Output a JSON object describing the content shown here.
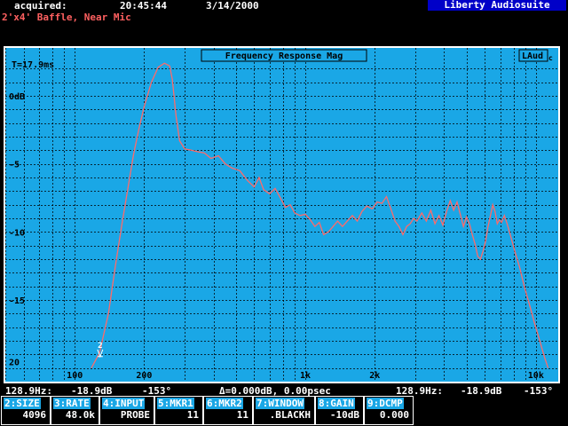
{
  "header": {
    "acquired_label": "acquired:",
    "time": "20:45:44",
    "date": "3/14/2000",
    "brand": "Liberty Audiosuite",
    "subtitle": "2'x4' Baffle, Near Mic"
  },
  "plot": {
    "title": "Frequency Response Mag",
    "logo": "LAud",
    "logo_sub": "c",
    "time_label": "T=17.9ms",
    "marker_label": "2",
    "background": "#1aa7e6",
    "trace_color": "#ff6a6a"
  },
  "chart_data": {
    "type": "line",
    "title": "Frequency Response Mag",
    "xscale": "log",
    "xlim": [
      50,
      12500
    ],
    "ylim": [
      -21,
      3
    ],
    "ylabel_ticks": [
      "0dB",
      "-5",
      "-10",
      "-15",
      "20"
    ],
    "ytick_values": [
      0,
      -5,
      -10,
      -15,
      -20
    ],
    "xtick_labels": [
      "100",
      "200",
      "1k",
      "2k",
      "10k"
    ],
    "xtick_values": [
      100,
      200,
      1000,
      2000,
      10000
    ],
    "grid": true,
    "series": [
      {
        "points": [
          [
            118,
            -20
          ],
          [
            128,
            -18.9
          ],
          [
            140,
            -16
          ],
          [
            150,
            -12.5
          ],
          [
            160,
            -9.5
          ],
          [
            170,
            -6.8
          ],
          [
            180,
            -4.3
          ],
          [
            190,
            -2.4
          ],
          [
            200,
            -0.8
          ],
          [
            215,
            1
          ],
          [
            230,
            2.1
          ],
          [
            245,
            2.4
          ],
          [
            258,
            2.2
          ],
          [
            265,
            1.2
          ],
          [
            275,
            -1.5
          ],
          [
            285,
            -3.3
          ],
          [
            300,
            -3.9
          ],
          [
            320,
            -4.0
          ],
          [
            340,
            -4.1
          ],
          [
            365,
            -4.2
          ],
          [
            390,
            -4.6
          ],
          [
            420,
            -4.4
          ],
          [
            450,
            -5.0
          ],
          [
            480,
            -5.3
          ],
          [
            520,
            -5.5
          ],
          [
            560,
            -6.2
          ],
          [
            600,
            -6.7
          ],
          [
            630,
            -6.0
          ],
          [
            660,
            -6.9
          ],
          [
            700,
            -7.2
          ],
          [
            740,
            -6.8
          ],
          [
            780,
            -7.5
          ],
          [
            820,
            -8.2
          ],
          [
            860,
            -8.0
          ],
          [
            900,
            -8.6
          ],
          [
            950,
            -8.8
          ],
          [
            1000,
            -8.7
          ],
          [
            1050,
            -9.1
          ],
          [
            1100,
            -9.6
          ],
          [
            1150,
            -9.3
          ],
          [
            1200,
            -10.2
          ],
          [
            1260,
            -10.0
          ],
          [
            1320,
            -9.6
          ],
          [
            1380,
            -9.2
          ],
          [
            1450,
            -9.6
          ],
          [
            1520,
            -9.2
          ],
          [
            1600,
            -8.8
          ],
          [
            1680,
            -9.2
          ],
          [
            1760,
            -8.5
          ],
          [
            1850,
            -8.1
          ],
          [
            1950,
            -8.3
          ],
          [
            2050,
            -7.8
          ],
          [
            2150,
            -7.9
          ],
          [
            2250,
            -7.4
          ],
          [
            2350,
            -8.3
          ],
          [
            2450,
            -9.2
          ],
          [
            2550,
            -9.6
          ],
          [
            2650,
            -10.2
          ],
          [
            2750,
            -9.6
          ],
          [
            2850,
            -9.4
          ],
          [
            2950,
            -9.0
          ],
          [
            3050,
            -9.2
          ],
          [
            3200,
            -8.6
          ],
          [
            3350,
            -9.2
          ],
          [
            3500,
            -8.4
          ],
          [
            3650,
            -9.4
          ],
          [
            3800,
            -8.8
          ],
          [
            3950,
            -9.5
          ],
          [
            4100,
            -8.5
          ],
          [
            4250,
            -7.7
          ],
          [
            4400,
            -8.4
          ],
          [
            4550,
            -7.8
          ],
          [
            4700,
            -8.7
          ],
          [
            4850,
            -9.6
          ],
          [
            5000,
            -8.9
          ],
          [
            5150,
            -9.4
          ],
          [
            5300,
            -10.2
          ],
          [
            5450,
            -10.9
          ],
          [
            5600,
            -11.8
          ],
          [
            5750,
            -12.0
          ],
          [
            5900,
            -11.4
          ],
          [
            6050,
            -10.7
          ],
          [
            6200,
            -9.6
          ],
          [
            6350,
            -8.8
          ],
          [
            6500,
            -8.0
          ],
          [
            6650,
            -8.5
          ],
          [
            6800,
            -9.4
          ],
          [
            6950,
            -9.1
          ],
          [
            7100,
            -9.3
          ],
          [
            7300,
            -8.8
          ],
          [
            7500,
            -9.4
          ],
          [
            7800,
            -10.4
          ],
          [
            8100,
            -11.4
          ],
          [
            8500,
            -12.6
          ],
          [
            8900,
            -14.0
          ],
          [
            9400,
            -15.4
          ],
          [
            9900,
            -16.8
          ],
          [
            10400,
            -18.0
          ],
          [
            10900,
            -19.2
          ],
          [
            11300,
            -20.0
          ]
        ]
      }
    ]
  },
  "status": {
    "left_freq": "128.9Hz:",
    "left_mag": "-18.9dB",
    "left_phase": "-153°",
    "delta": "Δ=0.000dB, 0.00psec",
    "right_freq": "128.9Hz:",
    "right_mag": "-18.9dB",
    "right_phase": "-153°"
  },
  "softkeys": [
    {
      "label": "2:SIZE",
      "value": "4096"
    },
    {
      "label": "3:RATE",
      "value": "48.0k"
    },
    {
      "label": "4:INPUT",
      "value": "PROBE"
    },
    {
      "label": "5:MKR1",
      "value": "11"
    },
    {
      "label": "6:MKR2",
      "value": "11"
    },
    {
      "label": "7:WINDOW",
      "value": ".BLACKH"
    },
    {
      "label": "8:GAIN",
      "value": "-10dB"
    },
    {
      "label": "9:DCMP",
      "value": "0.000"
    }
  ]
}
